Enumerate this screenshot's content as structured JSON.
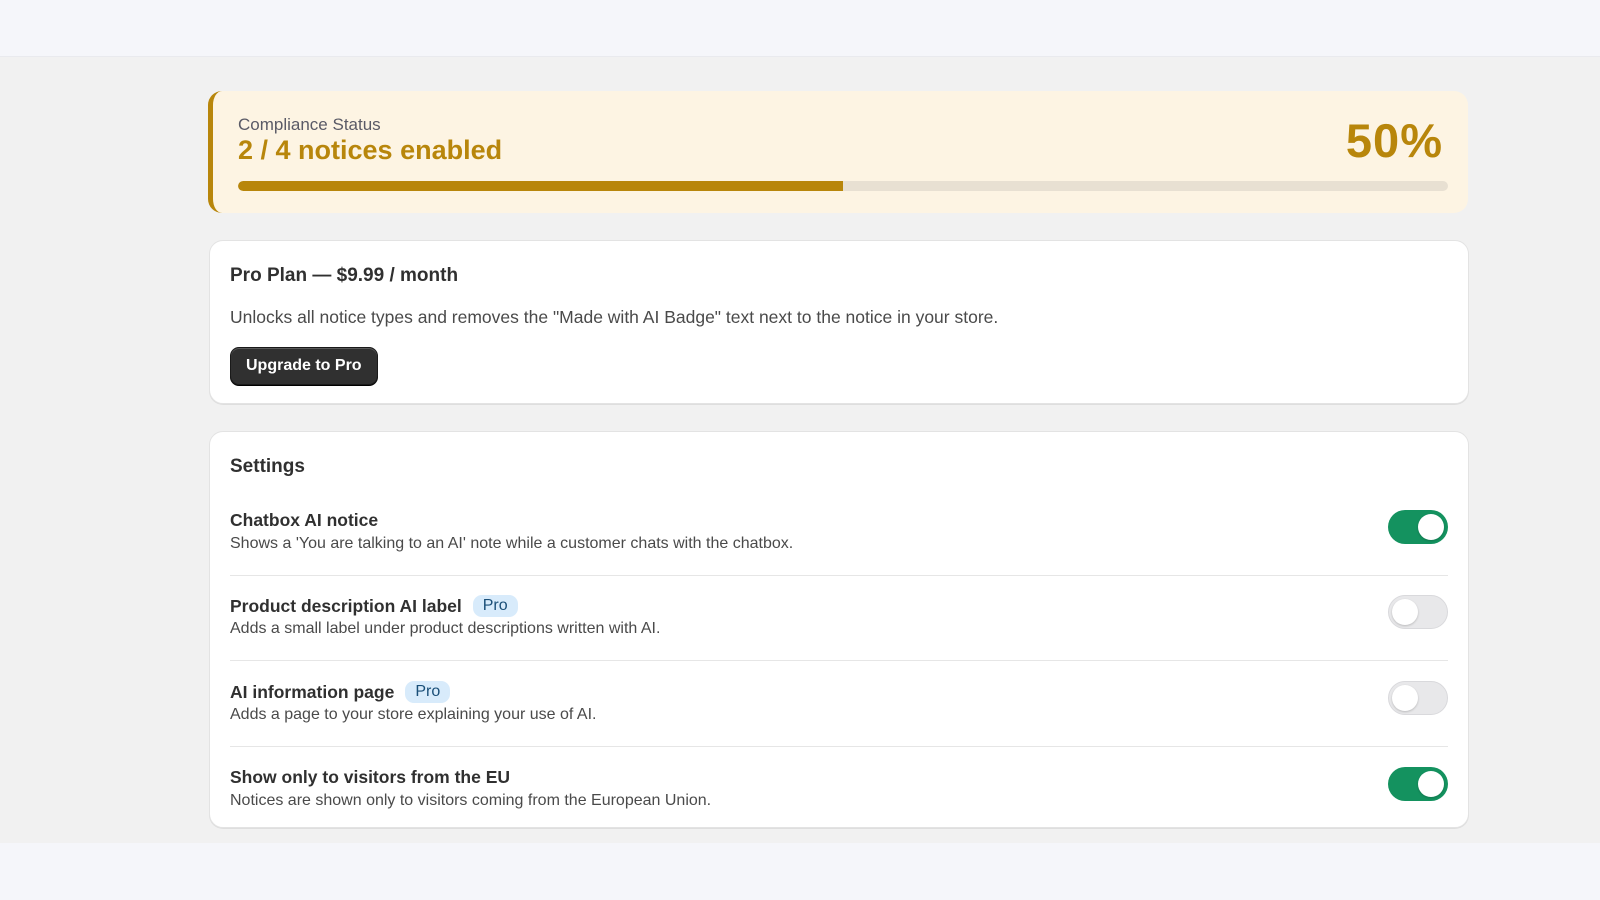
{
  "compliance": {
    "eyebrow": "Compliance Status",
    "headline": "2 / 4 notices enabled",
    "percent_label": "50%",
    "progress_fraction": 0.5,
    "accent_color": "#b8860b",
    "background_color": "#fdf4e3"
  },
  "plan": {
    "title": "Pro Plan — $9.99 / month",
    "description": "Unlocks all notice types and removes the \"Made with AI Badge\" text next to the notice in your store.",
    "upgrade_label": "Upgrade to Pro"
  },
  "settings": {
    "title": "Settings",
    "pro_badge_label": "Pro",
    "items": [
      {
        "name": "Chatbox AI notice",
        "description": "Shows a 'You are talking to an AI' note while a customer chats with the chatbox.",
        "pro": false,
        "enabled": true
      },
      {
        "name": "Product description AI label",
        "description": "Adds a small label under product descriptions written with AI.",
        "pro": true,
        "enabled": false
      },
      {
        "name": "AI information page",
        "description": "Adds a page to your store explaining your use of AI.",
        "pro": true,
        "enabled": false
      },
      {
        "name": "Show only to visitors from the EU",
        "description": "Notices are shown only to visitors coming from the European Union.",
        "pro": false,
        "enabled": true
      }
    ]
  },
  "colors": {
    "toggle_on": "#14925f",
    "toggle_off": "#e8e8ea",
    "pro_badge_bg": "#d8ebfb",
    "button_bg": "#303030"
  }
}
